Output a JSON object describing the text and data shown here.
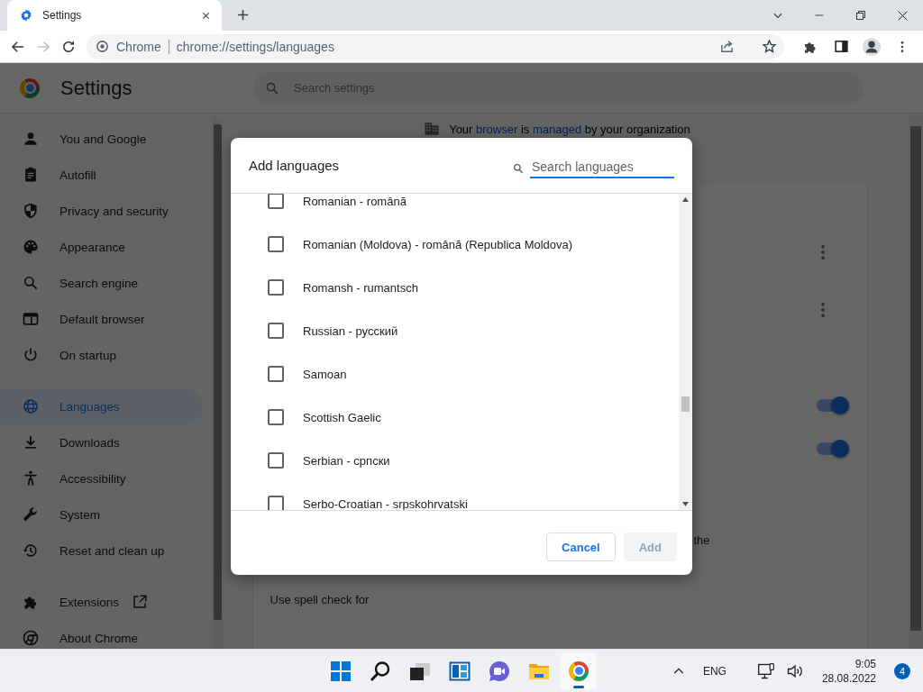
{
  "browser": {
    "tab": {
      "title": "Settings"
    },
    "omnibox": {
      "site_label": "Chrome",
      "url": "chrome://settings/languages"
    }
  },
  "settings": {
    "title": "Settings",
    "search": {
      "placeholder": "Search settings"
    },
    "sidebar": {
      "groups": [
        {
          "items": [
            {
              "label": "You and Google",
              "selected": false
            },
            {
              "label": "Autofill",
              "selected": false
            },
            {
              "label": "Privacy and security",
              "selected": false
            },
            {
              "label": "Appearance",
              "selected": false
            },
            {
              "label": "Search engine",
              "selected": false
            },
            {
              "label": "Default browser",
              "selected": false
            },
            {
              "label": "On startup",
              "selected": false
            }
          ]
        },
        {
          "items": [
            {
              "label": "Languages",
              "selected": true
            },
            {
              "label": "Downloads",
              "selected": false
            },
            {
              "label": "Accessibility",
              "selected": false
            },
            {
              "label": "System",
              "selected": false
            },
            {
              "label": "Reset and clean up",
              "selected": false
            }
          ]
        },
        {
          "items": [
            {
              "label": "Extensions",
              "selected": false,
              "external": true
            },
            {
              "label": "About Chrome",
              "selected": false,
              "external": false
            }
          ]
        }
      ]
    },
    "managed_notice": [
      {
        "kind": "text",
        "text": "Your "
      },
      {
        "kind": "link",
        "text": "browser"
      },
      {
        "kind": "text",
        "text": " is "
      },
      {
        "kind": "link",
        "text": "managed"
      },
      {
        "kind": "text",
        "text": " by your organization"
      }
    ],
    "toggles": [
      {
        "on": true
      },
      {
        "on": true
      }
    ],
    "partial_text": "the",
    "spell_check_label": "Use spell check for"
  },
  "dialog": {
    "title": "Add languages",
    "search": {
      "placeholder": "Search languages"
    },
    "languages": [
      {
        "label": "Romanian - română",
        "checked": false
      },
      {
        "label": "Romanian (Moldova) - română (Republica Moldova)",
        "checked": false
      },
      {
        "label": "Romansh - rumantsch",
        "checked": false
      },
      {
        "label": "Russian - русский",
        "checked": false
      },
      {
        "label": "Samoan",
        "checked": false
      },
      {
        "label": "Scottish Gaelic",
        "checked": false
      },
      {
        "label": "Serbian - српски",
        "checked": false
      },
      {
        "label": "Serbo-Croatian - srpskohrvatski",
        "checked": false
      }
    ],
    "buttons": [
      {
        "label": "Cancel",
        "disabled": false
      },
      {
        "label": "Add",
        "disabled": true
      }
    ]
  },
  "taskbar": {
    "apps": [
      {
        "kind": "start",
        "selected": false
      },
      {
        "kind": "search",
        "selected": false
      },
      {
        "kind": "taskview",
        "selected": false
      },
      {
        "kind": "widgets",
        "selected": false
      },
      {
        "kind": "chat",
        "selected": false
      },
      {
        "kind": "explorer",
        "selected": false
      },
      {
        "kind": "browser",
        "selected": true
      }
    ],
    "language": "ENG",
    "time": "9:05",
    "date": "28.08.2022",
    "notification_count": "4"
  }
}
